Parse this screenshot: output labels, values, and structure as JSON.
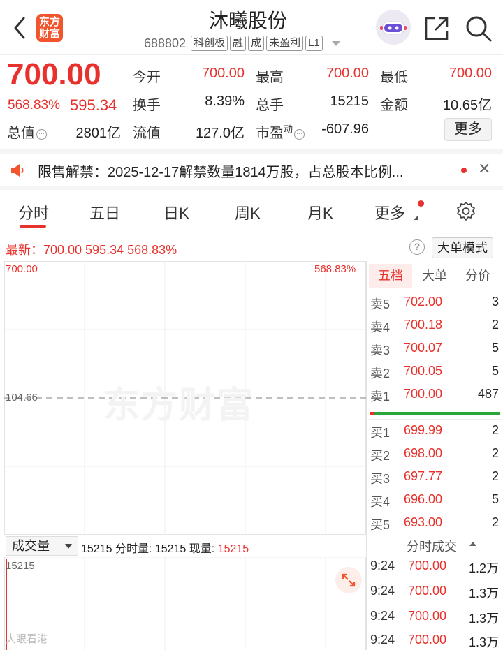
{
  "header": {
    "logo_text_1": "东方",
    "logo_text_2": "财富",
    "stock_name": "沐曦股份",
    "code": "688802",
    "tags": [
      "科创板",
      "融",
      "成",
      "未盈利",
      "L1"
    ]
  },
  "quote": {
    "price": "700.00",
    "change_pct": "568.83%",
    "change_amt": "595.34",
    "fields": [
      {
        "label": "今开",
        "value": "700.00",
        "color": "#e8312c"
      },
      {
        "label": "最高",
        "value": "700.00",
        "color": "#e8312c"
      },
      {
        "label": "最低",
        "value": "700.00",
        "color": "#e8312c"
      },
      {
        "label": "换手",
        "value": "8.39%",
        "color": "#222"
      },
      {
        "label": "总手",
        "value": "15215",
        "color": "#222"
      },
      {
        "label": "金额",
        "value": "10.65亿",
        "color": "#222"
      },
      {
        "label": "总值",
        "value": "2801亿",
        "color": "#222"
      },
      {
        "label": "流值",
        "value": "127.0亿",
        "color": "#222"
      },
      {
        "label": "市盈",
        "label_sup": "动",
        "value": "-607.96",
        "color": "#222"
      }
    ],
    "more_button": "更多"
  },
  "notice": {
    "text": "限售解禁：2025-12-17解禁数量1814万股，占总股本比例..."
  },
  "tabs": [
    "分时",
    "五日",
    "日K",
    "周K",
    "月K",
    "更多"
  ],
  "latest": {
    "text": "最新：700.00  595.34  568.83%",
    "big_order_mode": "大单模式"
  },
  "chart": {
    "watermark": "东方财富",
    "y_top": "700.00",
    "y_top_pct": "568.83%",
    "y_mid": "104.66"
  },
  "order_book": {
    "tabs": [
      "五档",
      "大单",
      "分价"
    ],
    "sells": [
      {
        "label": "卖5",
        "price": "702.00",
        "volume": "3"
      },
      {
        "label": "卖4",
        "price": "700.18",
        "volume": "2"
      },
      {
        "label": "卖3",
        "price": "700.07",
        "volume": "5"
      },
      {
        "label": "卖2",
        "price": "700.05",
        "volume": "5"
      },
      {
        "label": "卖1",
        "price": "700.00",
        "volume": "487"
      }
    ],
    "buys": [
      {
        "label": "买1",
        "price": "699.99",
        "volume": "2"
      },
      {
        "label": "买2",
        "price": "698.00",
        "volume": "2"
      },
      {
        "label": "买3",
        "price": "697.77",
        "volume": "2"
      },
      {
        "label": "买4",
        "price": "696.00",
        "volume": "5"
      },
      {
        "label": "买5",
        "price": "693.00",
        "volume": "2"
      }
    ]
  },
  "volume": {
    "selector": "成交量",
    "info_prefix": "15215 分时量: 15215 现量: ",
    "info_current": "15215",
    "label": "15215"
  },
  "ticks": {
    "title": "分时成交",
    "rows": [
      {
        "time": "9:24",
        "price": "700.00",
        "volume": "1.2万"
      },
      {
        "time": "9:24",
        "price": "700.00",
        "volume": "1.3万"
      },
      {
        "time": "9:24",
        "price": "700.00",
        "volume": "1.3万"
      },
      {
        "time": "9:24",
        "price": "700.00",
        "volume": "1.3万"
      }
    ]
  },
  "watermark_weibo": "大眼看港"
}
